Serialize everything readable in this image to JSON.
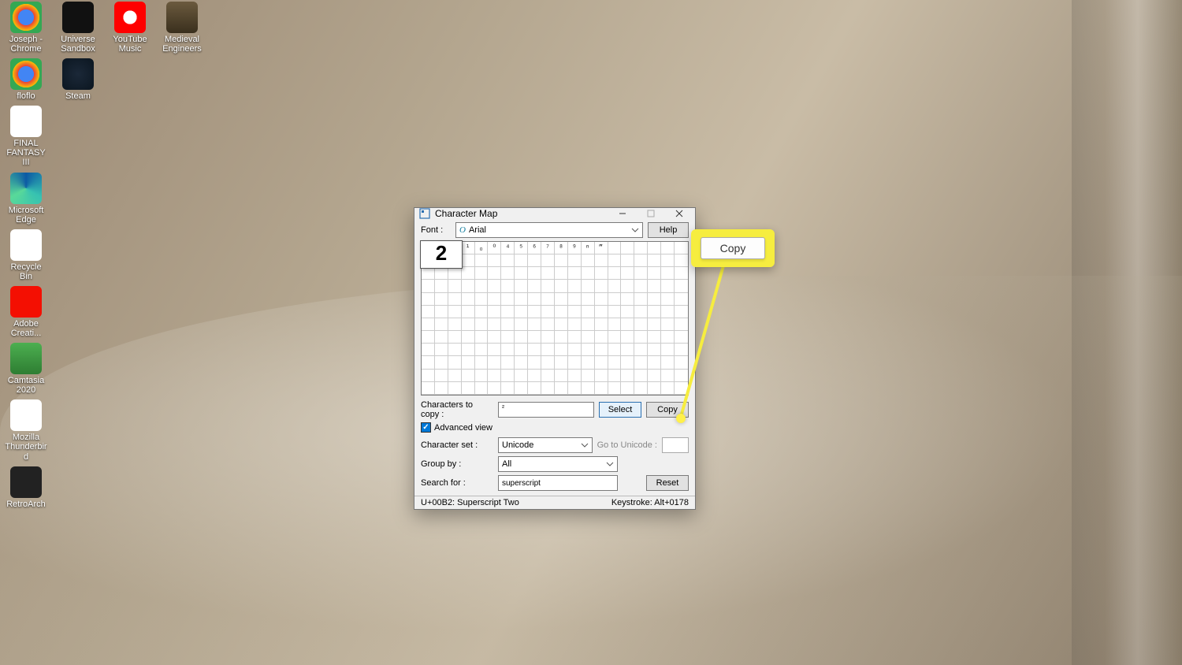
{
  "desktop": {
    "col1": [
      {
        "label": "Joseph - Chrome",
        "bg": "radial-gradient(circle,#4285f4 35%,#ea4335 36%,#fbbc05 60%,#34a853 61%)"
      },
      {
        "label": "floflo",
        "bg": "radial-gradient(circle,#4285f4 35%,#ea4335 36%,#fbbc05 60%,#34a853 61%)"
      },
      {
        "label": "FINAL FANTASY III",
        "bg": "linear-gradient(#fff,#fff)"
      },
      {
        "label": "Microsoft Edge",
        "bg": "conic-gradient(#0c59a4,#37c2b1,#59d999,#0c59a4)"
      },
      {
        "label": "Recycle Bin",
        "bg": "linear-gradient(#fff,#fff)"
      },
      {
        "label": "Adobe Creati...",
        "bg": "linear-gradient(#f40f02,#f40f02)"
      },
      {
        "label": "Camtasia 2020",
        "bg": "linear-gradient(#4caf50,#2e7d32)"
      },
      {
        "label": "Mozilla Thunderbird",
        "bg": "linear-gradient(#fff,#fff)"
      },
      {
        "label": "RetroArch",
        "bg": "linear-gradient(#222,#222)"
      }
    ],
    "col2": [
      {
        "label": "Universe Sandbox",
        "bg": "linear-gradient(#111,#111)"
      },
      {
        "label": "Steam",
        "bg": "radial-gradient(circle,#1b2838,#0b1620)"
      }
    ],
    "col3": [
      {
        "label": "YouTube Music",
        "bg": "radial-gradient(circle,#fff 30%,#ff0000 31%)"
      }
    ],
    "col4": [
      {
        "label": "Medieval Engineers",
        "bg": "linear-gradient(#6b5a3e,#3a2f1d)"
      }
    ]
  },
  "window": {
    "title": "Character Map",
    "font_label": "Font :",
    "font_italic": "O",
    "font_name": "Arial",
    "help_label": "Help",
    "preview_char": "2",
    "grid_chars": [
      "",
      "",
      "",
      "¹",
      "₀",
      "⁰",
      "⁴",
      "⁵",
      "⁶",
      "⁷",
      "⁸",
      "⁹",
      "ⁿ",
      "‴"
    ],
    "chars_to_copy_label": "Characters to copy :",
    "chars_to_copy": "²",
    "select_label": "Select",
    "copy_label": "Copy",
    "advanced_label": "Advanced view",
    "charset_label": "Character set :",
    "charset_value": "Unicode",
    "go_unicode_label": "Go to Unicode :",
    "groupby_label": "Group by :",
    "groupby_value": "All",
    "search_label": "Search for :",
    "search_value": "superscript",
    "reset_label": "Reset",
    "status_left": "U+00B2: Superscript Two",
    "status_right": "Keystroke: Alt+0178"
  },
  "callout": {
    "label": "Copy"
  }
}
